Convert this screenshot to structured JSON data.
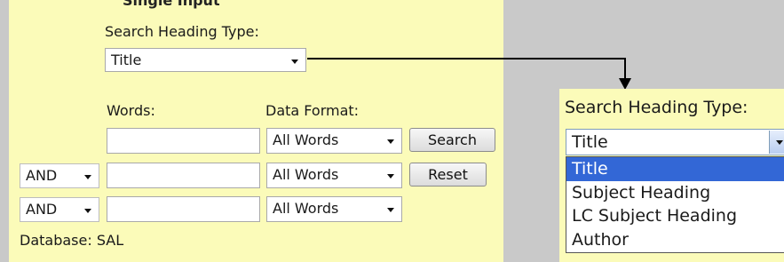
{
  "left_form": {
    "clipped_heading": "Single Input",
    "heading_type_label": "Search Heading Type:",
    "heading_type_selected": "Title",
    "words_label": "Words:",
    "data_format_label": "Data Format:",
    "rows": [
      {
        "operator": "",
        "word_value": "",
        "format": "All Words"
      },
      {
        "operator": "AND",
        "word_value": "",
        "format": "All Words"
      },
      {
        "operator": "AND",
        "word_value": "",
        "format": "All Words"
      }
    ],
    "search_button": "Search",
    "reset_button": "Reset",
    "database_text": "Database: SAL"
  },
  "zoom_inset": {
    "heading_type_label": "Search Heading Type:",
    "selected": "Title",
    "options": [
      "Title",
      "Subject Heading",
      "LC Subject Heading",
      "Author"
    ],
    "highlighted_index": 0
  },
  "colors": {
    "panel_bg": "#fbfbb9",
    "page_bg": "#c9c9c9",
    "highlight": "#3367d6"
  },
  "icons": [
    "dropdown-arrow-icon",
    "connector-arrow-icon"
  ]
}
